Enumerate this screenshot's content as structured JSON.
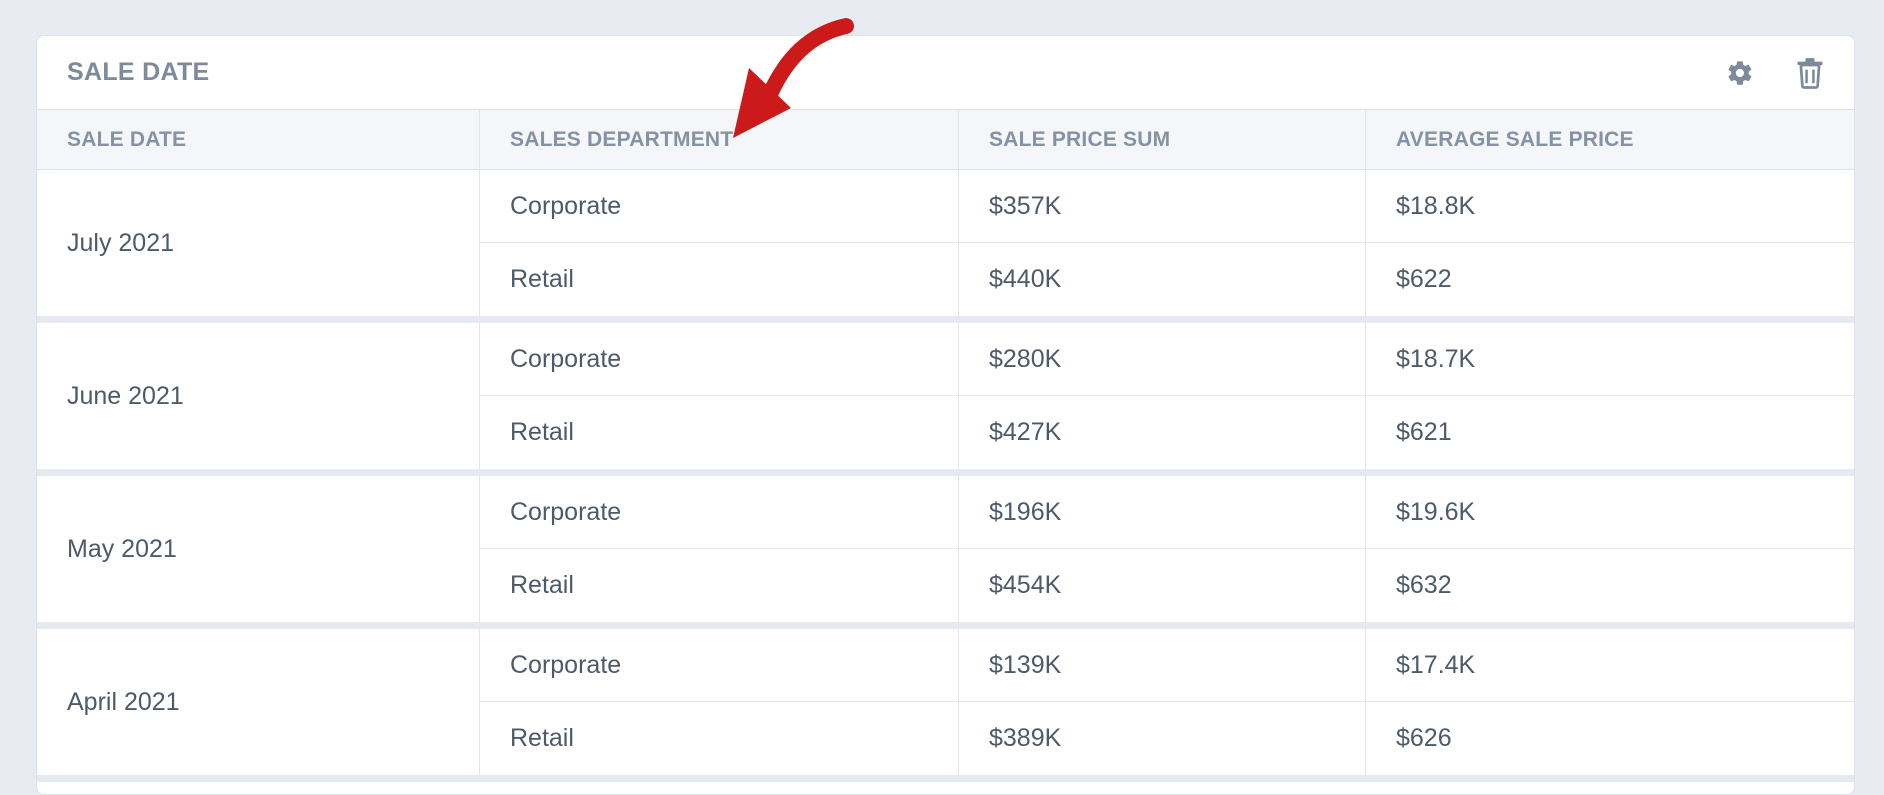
{
  "card": {
    "title": "SALE DATE",
    "accent": "#cc1a1a"
  },
  "table": {
    "headers": [
      "SALE DATE",
      "SALES DEPARTMENT",
      "SALE PRICE SUM",
      "AVERAGE SALE PRICE"
    ],
    "groups": [
      {
        "date": "July 2021",
        "rows": [
          {
            "department": "Corporate",
            "sum": "$357K",
            "avg": "$18.8K"
          },
          {
            "department": "Retail",
            "sum": "$440K",
            "avg": "$622"
          }
        ]
      },
      {
        "date": "June 2021",
        "rows": [
          {
            "department": "Corporate",
            "sum": "$280K",
            "avg": "$18.7K"
          },
          {
            "department": "Retail",
            "sum": "$427K",
            "avg": "$621"
          }
        ]
      },
      {
        "date": "May 2021",
        "rows": [
          {
            "department": "Corporate",
            "sum": "$196K",
            "avg": "$19.6K"
          },
          {
            "department": "Retail",
            "sum": "$454K",
            "avg": "$632"
          }
        ]
      },
      {
        "date": "April 2021",
        "rows": [
          {
            "department": "Corporate",
            "sum": "$139K",
            "avg": "$17.4K"
          },
          {
            "department": "Retail",
            "sum": "$389K",
            "avg": "$626"
          }
        ]
      }
    ]
  },
  "icons": {
    "settings": "gear-icon",
    "delete": "trash-icon",
    "annotation": "red-arrow-annotation"
  }
}
